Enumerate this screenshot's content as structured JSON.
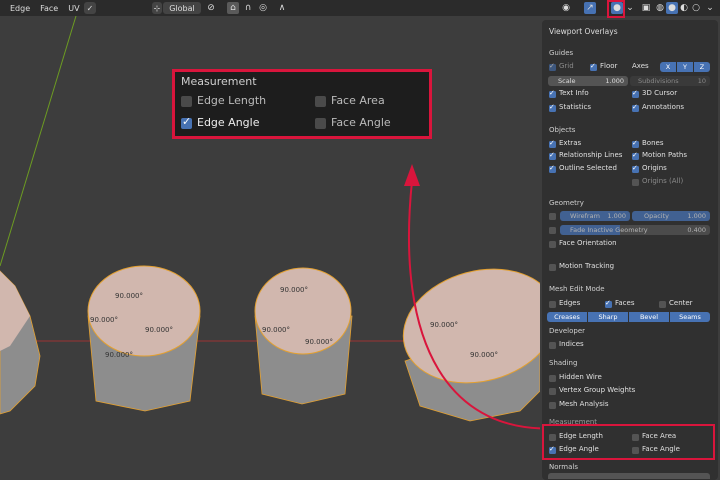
{
  "menu": {
    "items": [
      "Edge",
      "Face",
      "UV"
    ]
  },
  "header": {
    "orientation": "Global",
    "overlay_dropdown_symbol": "⌄"
  },
  "overlays": {
    "title": "Viewport Overlays",
    "guides": {
      "title": "Guides",
      "grid": "Grid",
      "floor": "Floor",
      "axes_label": "Axes",
      "axes": [
        "X",
        "Y",
        "Z"
      ],
      "scale_label": "Scale",
      "scale_value": "1.000",
      "subdivisions_label": "Subdivisions",
      "subdivisions_value": "10",
      "text_info": "Text Info",
      "cursor_3d": "3D Cursor",
      "statistics": "Statistics",
      "annotations": "Annotations"
    },
    "objects": {
      "title": "Objects",
      "extras": "Extras",
      "bones": "Bones",
      "relationship_lines": "Relationship Lines",
      "motion_paths": "Motion Paths",
      "outline_selected": "Outline Selected",
      "origins": "Origins",
      "origins_all": "Origins (All)"
    },
    "geometry": {
      "title": "Geometry",
      "wireframe_label": "Wirefram",
      "wireframe_value": "1.000",
      "opacity_label": "Opacity",
      "opacity_value": "1.000",
      "fade_label": "Fade Inactive Geometry",
      "fade_value": "0.400",
      "face_orientation": "Face Orientation"
    },
    "motion_tracking": "Motion Tracking",
    "mesh_edit": {
      "title": "Mesh Edit Mode",
      "edges": "Edges",
      "faces": "Faces",
      "center": "Center",
      "buttons": [
        "Creases",
        "Sharp",
        "Bevel",
        "Seams"
      ]
    },
    "developer": {
      "title": "Developer",
      "indices": "Indices"
    },
    "shading": {
      "title": "Shading",
      "hidden_wire": "Hidden Wire",
      "vertex_group_weights": "Vertex Group Weights",
      "mesh_analysis": "Mesh Analysis"
    },
    "measurement": {
      "title": "Measurement",
      "edge_length": "Edge Length",
      "face_area": "Face Area",
      "edge_angle": "Edge Angle",
      "face_angle": "Face Angle"
    },
    "normals": {
      "title": "Normals"
    }
  },
  "popup": {
    "title": "Measurement",
    "edge_length": "Edge Length",
    "face_area": "Face Area",
    "edge_angle": "Edge Angle",
    "face_angle": "Face Angle"
  },
  "viewport": {
    "angle_label": "90.000°"
  },
  "colors": {
    "highlight": "#d9153c",
    "checkbox_on": "#4772b3",
    "panel_bg": "#303030",
    "viewport_bg": "#3d3d3d",
    "cylinder_top": "#d1b7ae",
    "cylinder_side": "#8d8d8d",
    "angle_label": "#8fb315"
  }
}
